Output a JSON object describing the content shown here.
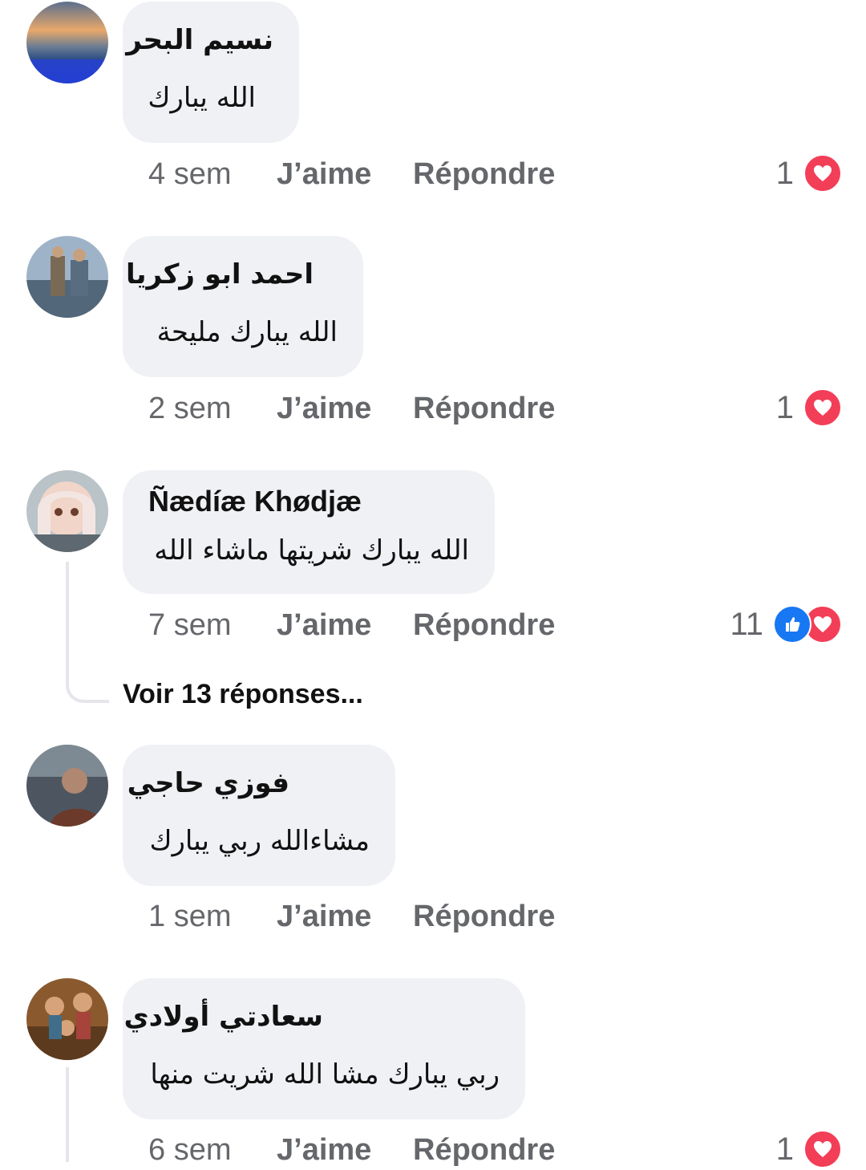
{
  "comments": [
    {
      "author": "نسيم البحر",
      "text": "الله يبارك",
      "time": "4 sem",
      "like_label": "J’aime",
      "reply_label": "Répondre",
      "reaction_count": "1"
    },
    {
      "author": "احمد ابو زكريا",
      "text": "الله يبارك مليحة",
      "time": "2 sem",
      "like_label": "J’aime",
      "reply_label": "Répondre",
      "reaction_count": "1"
    },
    {
      "author": "Ñædíæ Khødjæ",
      "text": "الله يبارك شريتها ماشاء الله",
      "time": "7 sem",
      "like_label": "J’aime",
      "reply_label": "Répondre",
      "reaction_count": "11",
      "view_replies": "Voir 13 réponses..."
    },
    {
      "author": "فوزي حاجي",
      "text": "مشاءالله ربي يبارك",
      "time": "1 sem",
      "like_label": "J’aime",
      "reply_label": "Répondre"
    },
    {
      "author": "سعادتي أولادي",
      "text": "ربي يبارك مشا الله شريت منها",
      "time": "6 sem",
      "like_label": "J’aime",
      "reply_label": "Répondre",
      "reaction_count": "1"
    }
  ],
  "reaction_icons": [
    "heart-icon",
    "like-icon"
  ],
  "colors": {
    "heart": "#f33e58",
    "like": "#1877f2",
    "bubble": "#eff1f4",
    "meta": "#65676b"
  }
}
